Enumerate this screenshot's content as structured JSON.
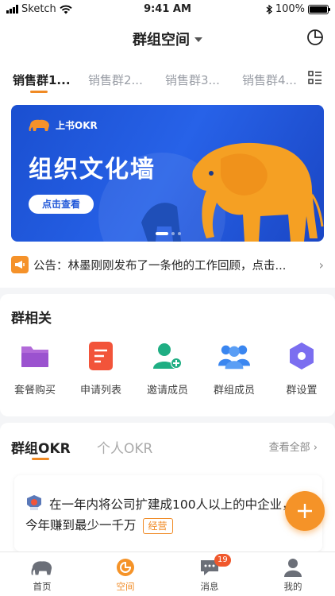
{
  "status_bar": {
    "carrier": "Sketch",
    "time": "9:41 AM",
    "battery": "100%"
  },
  "header": {
    "title": "群组空间"
  },
  "tabs": [
    {
      "label": "销售群1..."
    },
    {
      "label": "销售群2..."
    },
    {
      "label": "销售群3..."
    },
    {
      "label": "销售群4..."
    }
  ],
  "banner": {
    "brand": "上书OKR",
    "title": "组织文化墙",
    "button": "点击查看"
  },
  "notice": {
    "text": "公告：林墨刚刚发布了一条他的工作回顾，点击..."
  },
  "group_section": {
    "title": "群相关",
    "actions": [
      {
        "label": "套餐购买"
      },
      {
        "label": "申请列表"
      },
      {
        "label": "邀请成员"
      },
      {
        "label": "群组成员"
      },
      {
        "label": "群设置"
      }
    ]
  },
  "okr_section": {
    "tab_group": "群组OKR",
    "tab_personal": "个人OKR",
    "view_all": "查看全部",
    "item": {
      "text": "在一年内将公司扩建成100人以上的中企业，在今年赚到最少一千万",
      "tag": "经营"
    }
  },
  "tabbar": {
    "items": [
      {
        "label": "首页"
      },
      {
        "label": "空间"
      },
      {
        "label": "消息",
        "badge": "19"
      },
      {
        "label": "我的"
      }
    ]
  },
  "colors": {
    "accent": "#F08A24",
    "banner_blue": "#2158D8",
    "badge_red": "#F0582C"
  }
}
